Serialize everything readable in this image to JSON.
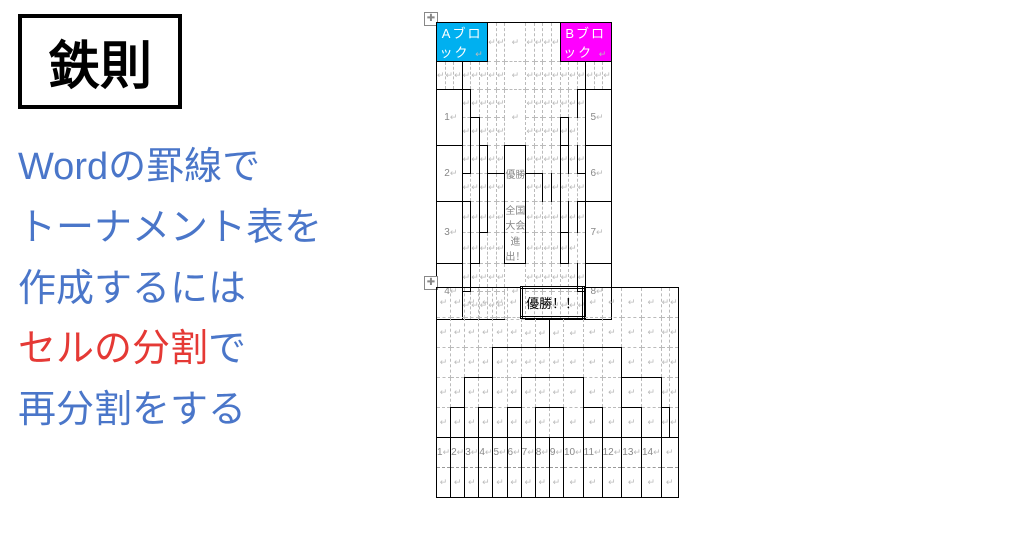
{
  "rule_label": "鉄則",
  "desc_line1": "Wordの罫線で",
  "desc_line2": "トーナメント表を",
  "desc_line3": "作成するには",
  "desc_line4": "セルの分割",
  "desc_line4b": "で",
  "desc_line5": "再分割をする",
  "top": {
    "block_a": "Aブロック",
    "block_b": "Bブロック",
    "winner": "優勝",
    "winner_sub1": "全国大会",
    "winner_sub2": "進出！",
    "left_nums": [
      "1",
      "2",
      "3",
      "4"
    ],
    "right_nums": [
      "5",
      "6",
      "7",
      "8"
    ]
  },
  "bottom": {
    "winner": "優勝！！",
    "teams": [
      "1",
      "2",
      "3",
      "4",
      "5",
      "6",
      "7",
      "8",
      "9",
      "10",
      "11",
      "12",
      "13",
      "14"
    ]
  }
}
